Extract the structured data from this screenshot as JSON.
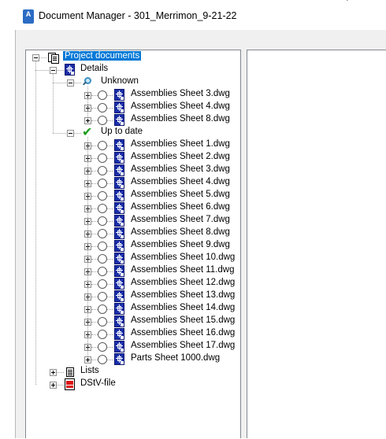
{
  "window": {
    "title": "Document Manager - 301_Merrimon_9-21-22",
    "app_icon_letter": "A"
  },
  "tree": {
    "root": {
      "label": "Project documents",
      "icon": "documents-icon",
      "selected": true
    },
    "details": {
      "label": "Details",
      "icon": "dwg-icon"
    },
    "unknown": {
      "label": "Unknown",
      "icon": "search-icon",
      "items": [
        "Assemblies Sheet 3.dwg",
        "Assemblies Sheet 4.dwg",
        "Assemblies Sheet 8.dwg"
      ]
    },
    "up_to_date": {
      "label": "Up to date",
      "icon": "check-icon",
      "items": [
        "Assemblies Sheet 1.dwg",
        "Assemblies Sheet 2.dwg",
        "Assemblies Sheet 3.dwg",
        "Assemblies Sheet 4.dwg",
        "Assemblies Sheet 5.dwg",
        "Assemblies Sheet 6.dwg",
        "Assemblies Sheet 7.dwg",
        "Assemblies Sheet 8.dwg",
        "Assemblies Sheet 9.dwg",
        "Assemblies Sheet 10.dwg",
        "Assemblies Sheet 11.dwg",
        "Assemblies Sheet 12.dwg",
        "Assemblies Sheet 13.dwg",
        "Assemblies Sheet 14.dwg",
        "Assemblies Sheet 15.dwg",
        "Assemblies Sheet 16.dwg",
        "Assemblies Sheet 17.dwg",
        "Parts Sheet 1000.dwg"
      ]
    },
    "lists": {
      "label": "Lists",
      "icon": "lists-icon"
    },
    "dstv": {
      "label": "DStV-file",
      "icon": "dstv-file-icon"
    }
  },
  "colors": {
    "selection": "#0078d7",
    "dwg_icon": "#1a2fa8",
    "check": "#1a9c1a",
    "pane_background": "#f0f0f0"
  }
}
